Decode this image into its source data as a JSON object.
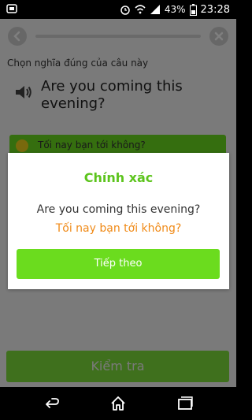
{
  "status_bar": {
    "battery_percent": "43%",
    "time": "23:28",
    "icons": [
      "notification-icon",
      "alarm-icon",
      "wifi-icon",
      "signal-icon",
      "battery-icon"
    ]
  },
  "lesson": {
    "progress": 0.0,
    "instruction": "Chọn nghĩa đúng của câu này",
    "question": "Are you coming this evening?",
    "option": "Tối nay bạn tới không?",
    "check_label": "Kiểm tra"
  },
  "dialog": {
    "title": "Chính xác",
    "english": "Are you coming this evening?",
    "translation": "Tối nay bạn tới không?",
    "continue_label": "Tiếp theo"
  },
  "colors": {
    "accent_green": "#6bdc1e",
    "title_green": "#5cc41c",
    "translation_orange": "#f08a17"
  }
}
